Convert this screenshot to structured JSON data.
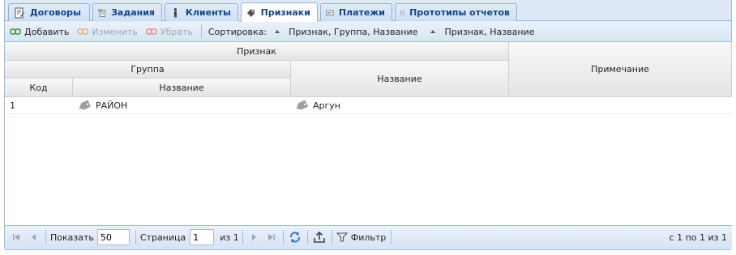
{
  "tabs": [
    {
      "label": "Договоры",
      "icon": "contract-icon"
    },
    {
      "label": "Задания",
      "icon": "task-icon"
    },
    {
      "label": "Клиенты",
      "icon": "person-icon"
    },
    {
      "label": "Признаки",
      "icon": "tags-icon",
      "active": true
    },
    {
      "label": "Платежи",
      "icon": "payment-icon"
    },
    {
      "label": "Прототипы отчетов",
      "icon": "report-icon"
    }
  ],
  "toolbar": {
    "add_label": "Добавить",
    "edit_label": "Изменить",
    "remove_label": "Убрать",
    "sort_label": "Сортировка:",
    "sort_items": [
      "Признак, Группа, Название",
      "Признак, Название"
    ]
  },
  "grid": {
    "header": {
      "priznak": "Признак",
      "gruppa": "Группа",
      "kod": "Код",
      "gruppa_nazvanie": "Название",
      "nazvanie": "Название",
      "primechanie": "Примечание"
    },
    "rows": [
      {
        "kod": "1",
        "gruppa_nazvanie": "РАЙОН",
        "nazvanie": "Аргун",
        "primechanie": ""
      }
    ]
  },
  "pager": {
    "show_label": "Показать",
    "page_size": "50",
    "page_label": "Страница",
    "page_value": "1",
    "of_label": "из 1",
    "filter_label": "Фильтр",
    "summary": "с 1 по 1 из 1"
  },
  "colors": {
    "tab_text": "#15428b",
    "panel_bg": "#dfe8f6",
    "border": "#99bbe8"
  }
}
